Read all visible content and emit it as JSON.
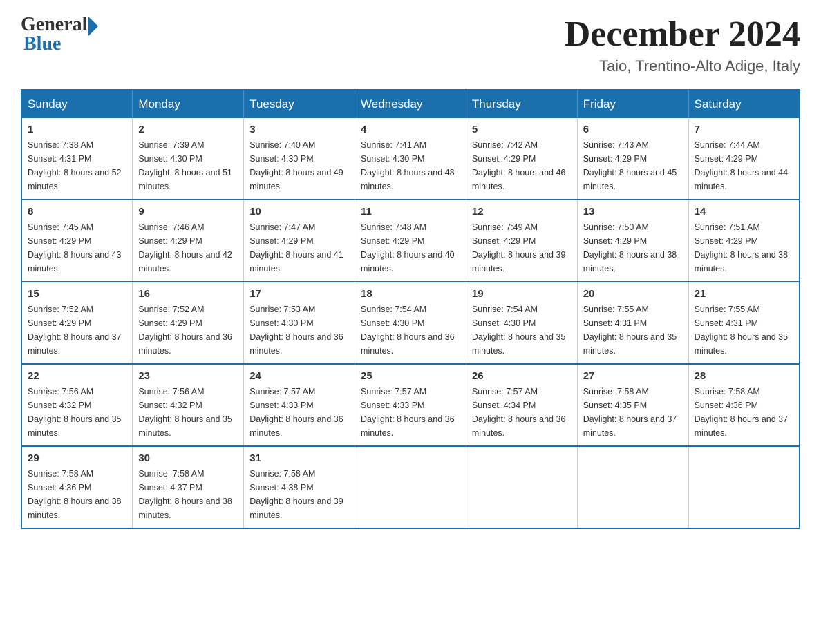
{
  "logo": {
    "general": "General",
    "blue": "Blue"
  },
  "title": {
    "month": "December 2024",
    "location": "Taio, Trentino-Alto Adige, Italy"
  },
  "days_header": [
    "Sunday",
    "Monday",
    "Tuesday",
    "Wednesday",
    "Thursday",
    "Friday",
    "Saturday"
  ],
  "weeks": [
    [
      {
        "day": "1",
        "sunrise": "7:38 AM",
        "sunset": "4:31 PM",
        "daylight": "8 hours and 52 minutes."
      },
      {
        "day": "2",
        "sunrise": "7:39 AM",
        "sunset": "4:30 PM",
        "daylight": "8 hours and 51 minutes."
      },
      {
        "day": "3",
        "sunrise": "7:40 AM",
        "sunset": "4:30 PM",
        "daylight": "8 hours and 49 minutes."
      },
      {
        "day": "4",
        "sunrise": "7:41 AM",
        "sunset": "4:30 PM",
        "daylight": "8 hours and 48 minutes."
      },
      {
        "day": "5",
        "sunrise": "7:42 AM",
        "sunset": "4:29 PM",
        "daylight": "8 hours and 46 minutes."
      },
      {
        "day": "6",
        "sunrise": "7:43 AM",
        "sunset": "4:29 PM",
        "daylight": "8 hours and 45 minutes."
      },
      {
        "day": "7",
        "sunrise": "7:44 AM",
        "sunset": "4:29 PM",
        "daylight": "8 hours and 44 minutes."
      }
    ],
    [
      {
        "day": "8",
        "sunrise": "7:45 AM",
        "sunset": "4:29 PM",
        "daylight": "8 hours and 43 minutes."
      },
      {
        "day": "9",
        "sunrise": "7:46 AM",
        "sunset": "4:29 PM",
        "daylight": "8 hours and 42 minutes."
      },
      {
        "day": "10",
        "sunrise": "7:47 AM",
        "sunset": "4:29 PM",
        "daylight": "8 hours and 41 minutes."
      },
      {
        "day": "11",
        "sunrise": "7:48 AM",
        "sunset": "4:29 PM",
        "daylight": "8 hours and 40 minutes."
      },
      {
        "day": "12",
        "sunrise": "7:49 AM",
        "sunset": "4:29 PM",
        "daylight": "8 hours and 39 minutes."
      },
      {
        "day": "13",
        "sunrise": "7:50 AM",
        "sunset": "4:29 PM",
        "daylight": "8 hours and 38 minutes."
      },
      {
        "day": "14",
        "sunrise": "7:51 AM",
        "sunset": "4:29 PM",
        "daylight": "8 hours and 38 minutes."
      }
    ],
    [
      {
        "day": "15",
        "sunrise": "7:52 AM",
        "sunset": "4:29 PM",
        "daylight": "8 hours and 37 minutes."
      },
      {
        "day": "16",
        "sunrise": "7:52 AM",
        "sunset": "4:29 PM",
        "daylight": "8 hours and 36 minutes."
      },
      {
        "day": "17",
        "sunrise": "7:53 AM",
        "sunset": "4:30 PM",
        "daylight": "8 hours and 36 minutes."
      },
      {
        "day": "18",
        "sunrise": "7:54 AM",
        "sunset": "4:30 PM",
        "daylight": "8 hours and 36 minutes."
      },
      {
        "day": "19",
        "sunrise": "7:54 AM",
        "sunset": "4:30 PM",
        "daylight": "8 hours and 35 minutes."
      },
      {
        "day": "20",
        "sunrise": "7:55 AM",
        "sunset": "4:31 PM",
        "daylight": "8 hours and 35 minutes."
      },
      {
        "day": "21",
        "sunrise": "7:55 AM",
        "sunset": "4:31 PM",
        "daylight": "8 hours and 35 minutes."
      }
    ],
    [
      {
        "day": "22",
        "sunrise": "7:56 AM",
        "sunset": "4:32 PM",
        "daylight": "8 hours and 35 minutes."
      },
      {
        "day": "23",
        "sunrise": "7:56 AM",
        "sunset": "4:32 PM",
        "daylight": "8 hours and 35 minutes."
      },
      {
        "day": "24",
        "sunrise": "7:57 AM",
        "sunset": "4:33 PM",
        "daylight": "8 hours and 36 minutes."
      },
      {
        "day": "25",
        "sunrise": "7:57 AM",
        "sunset": "4:33 PM",
        "daylight": "8 hours and 36 minutes."
      },
      {
        "day": "26",
        "sunrise": "7:57 AM",
        "sunset": "4:34 PM",
        "daylight": "8 hours and 36 minutes."
      },
      {
        "day": "27",
        "sunrise": "7:58 AM",
        "sunset": "4:35 PM",
        "daylight": "8 hours and 37 minutes."
      },
      {
        "day": "28",
        "sunrise": "7:58 AM",
        "sunset": "4:36 PM",
        "daylight": "8 hours and 37 minutes."
      }
    ],
    [
      {
        "day": "29",
        "sunrise": "7:58 AM",
        "sunset": "4:36 PM",
        "daylight": "8 hours and 38 minutes."
      },
      {
        "day": "30",
        "sunrise": "7:58 AM",
        "sunset": "4:37 PM",
        "daylight": "8 hours and 38 minutes."
      },
      {
        "day": "31",
        "sunrise": "7:58 AM",
        "sunset": "4:38 PM",
        "daylight": "8 hours and 39 minutes."
      },
      null,
      null,
      null,
      null
    ]
  ]
}
